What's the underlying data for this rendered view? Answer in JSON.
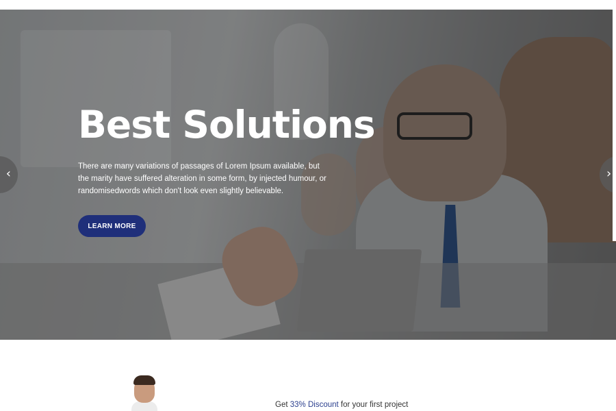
{
  "hero": {
    "title": "Best Solutions",
    "text_line1": "There are many variations of passages of Lorem Ipsum available, but",
    "text_line2": "the marity have suffered alteration in some form, by injected humour, or",
    "text_line3": "randomisedwords which don't look even slightly believable.",
    "button_label": "LEARN MORE",
    "prev_glyph": "‹",
    "next_glyph": "›"
  },
  "promo": {
    "prefix": "Get",
    "highlight": "33% Discount",
    "suffix": "for your first project"
  },
  "icons": {
    "prev": "chevron-left-icon",
    "next": "chevron-right-icon"
  },
  "colors": {
    "accent": "#1f2f7a",
    "highlight": "#2b3f8e"
  }
}
